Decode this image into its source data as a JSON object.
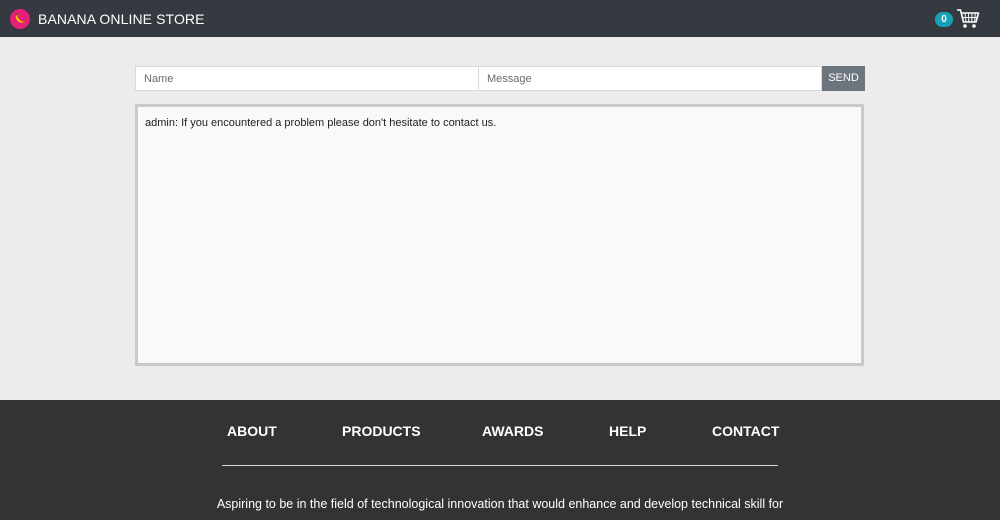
{
  "header": {
    "brand_name": "BANANA ONLINE STORE",
    "cart_count": "0"
  },
  "chat": {
    "name_placeholder": "Name",
    "message_placeholder": "Message",
    "send_label": "SEND",
    "messages": [
      "admin: If you encountered a problem please don't hesitate to contact us."
    ]
  },
  "footer": {
    "links": [
      "ABOUT",
      "PRODUCTS",
      "AWARDS",
      "HELP",
      "CONTACT"
    ],
    "text": "Aspiring to be in the field of technological innovation that would enhance and develop technical skill for"
  },
  "colors": {
    "header_bg": "#343a40",
    "logo": "#e61e78",
    "badge": "#17a2b8",
    "send_button": "#6c757d",
    "footer_bg": "#333333"
  }
}
